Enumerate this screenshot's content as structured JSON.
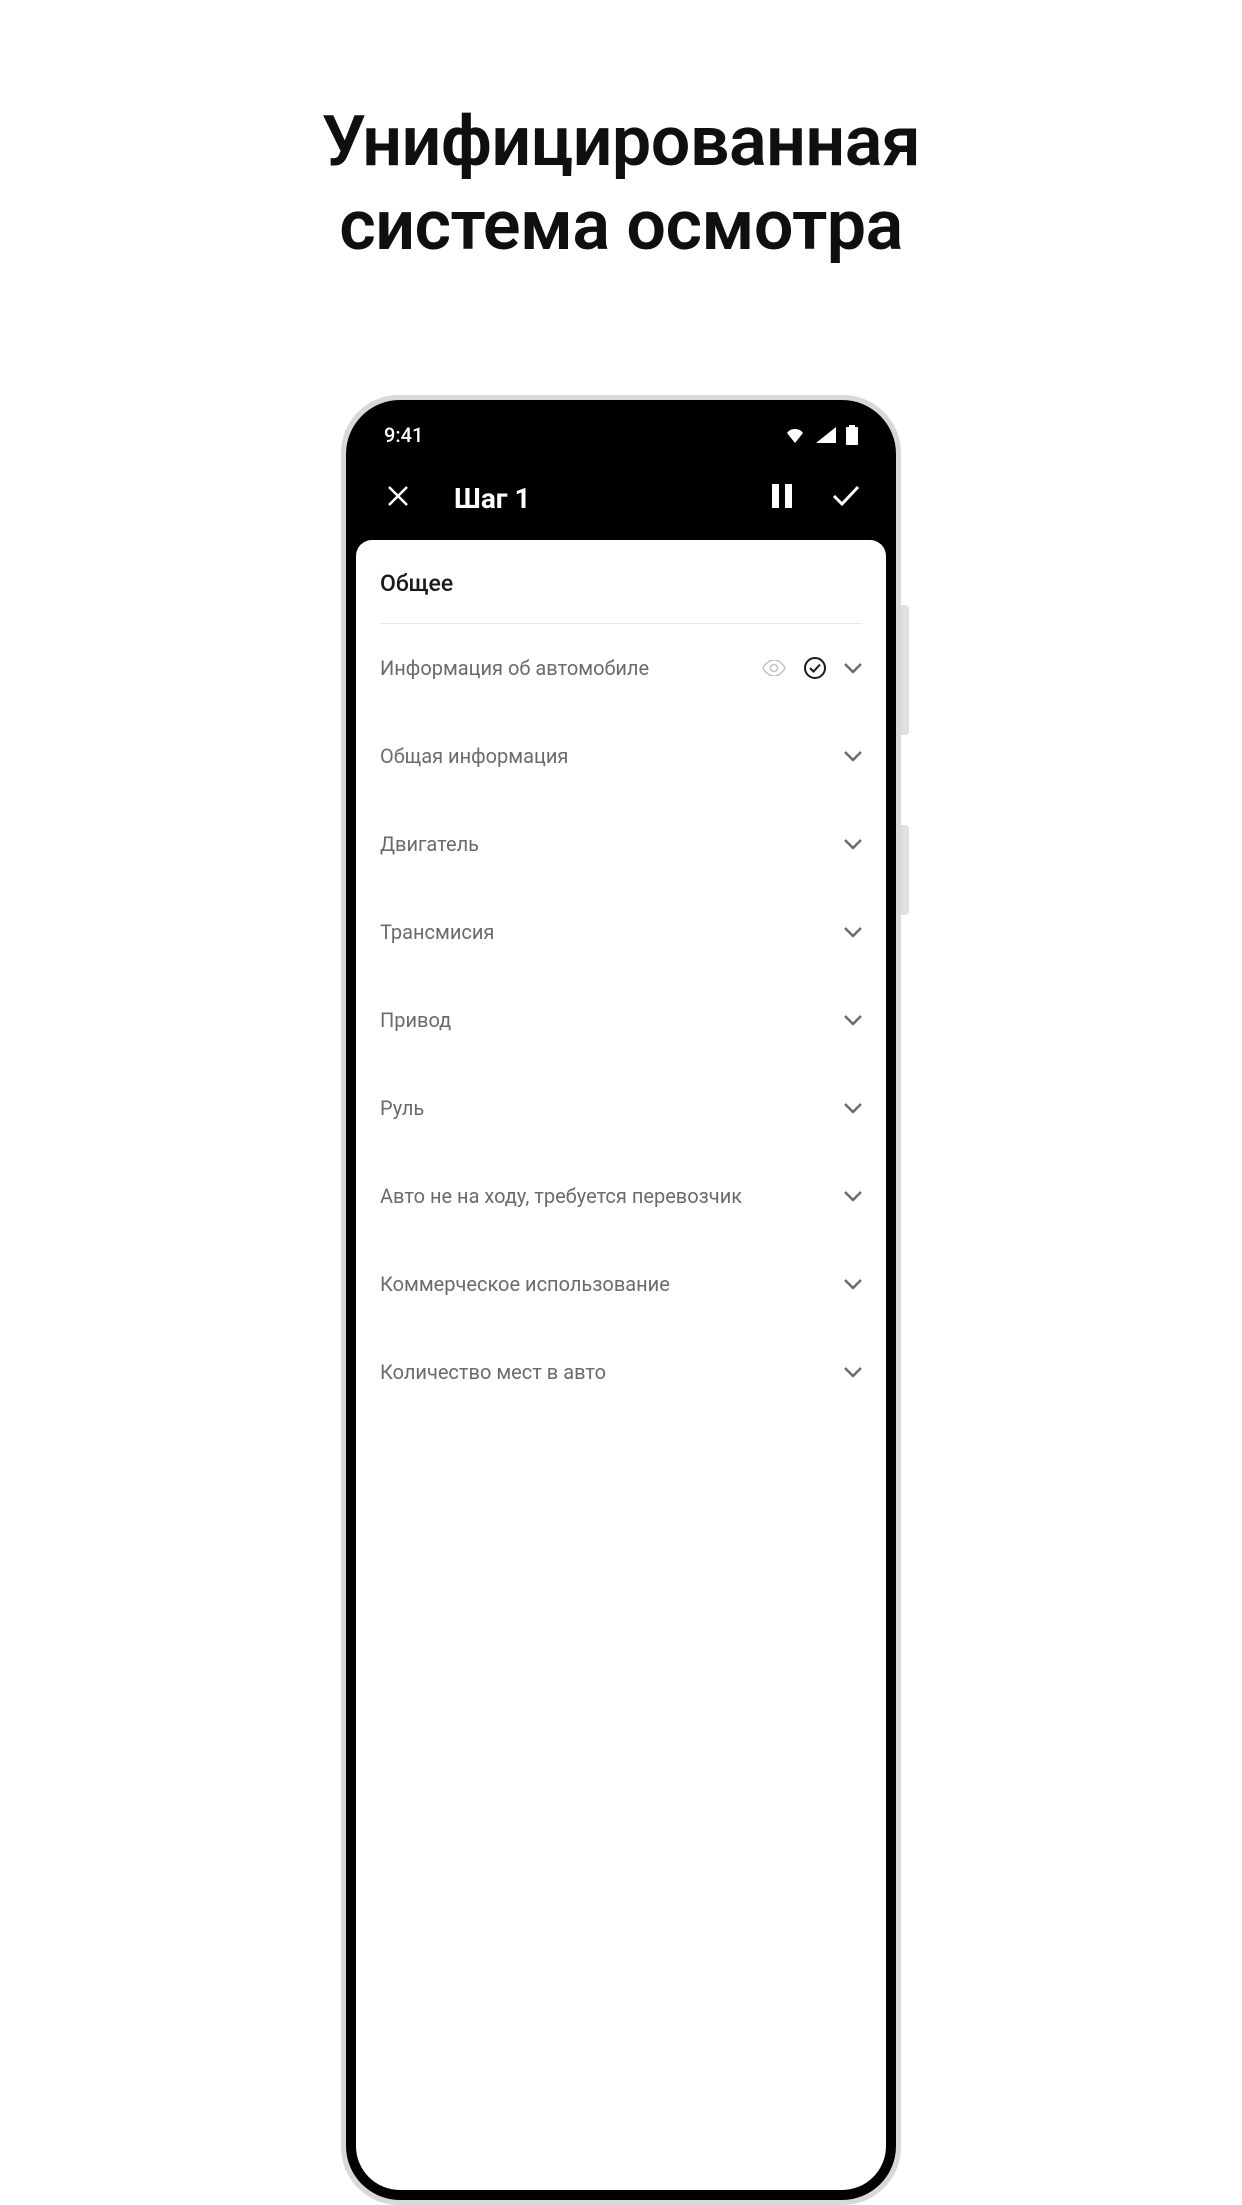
{
  "headline": {
    "line1": "Унифицированная",
    "line2": "система осмотра"
  },
  "statusBar": {
    "time": "9:41"
  },
  "appBar": {
    "title": "Шаг 1"
  },
  "content": {
    "sectionHeader": "Общее",
    "items": [
      {
        "label": "Информация об автомобиле",
        "hasEye": true,
        "hasCheck": true
      },
      {
        "label": "Общая информация",
        "hasEye": false,
        "hasCheck": false
      },
      {
        "label": "Двигатель",
        "hasEye": false,
        "hasCheck": false
      },
      {
        "label": "Трансмисия",
        "hasEye": false,
        "hasCheck": false
      },
      {
        "label": "Привод",
        "hasEye": false,
        "hasCheck": false
      },
      {
        "label": "Руль",
        "hasEye": false,
        "hasCheck": false
      },
      {
        "label": "Авто не на ходу, требуется перевозчик",
        "hasEye": false,
        "hasCheck": false
      },
      {
        "label": "Коммерческое использование",
        "hasEye": false,
        "hasCheck": false
      },
      {
        "label": "Количество мест в авто",
        "hasEye": false,
        "hasCheck": false
      }
    ]
  }
}
